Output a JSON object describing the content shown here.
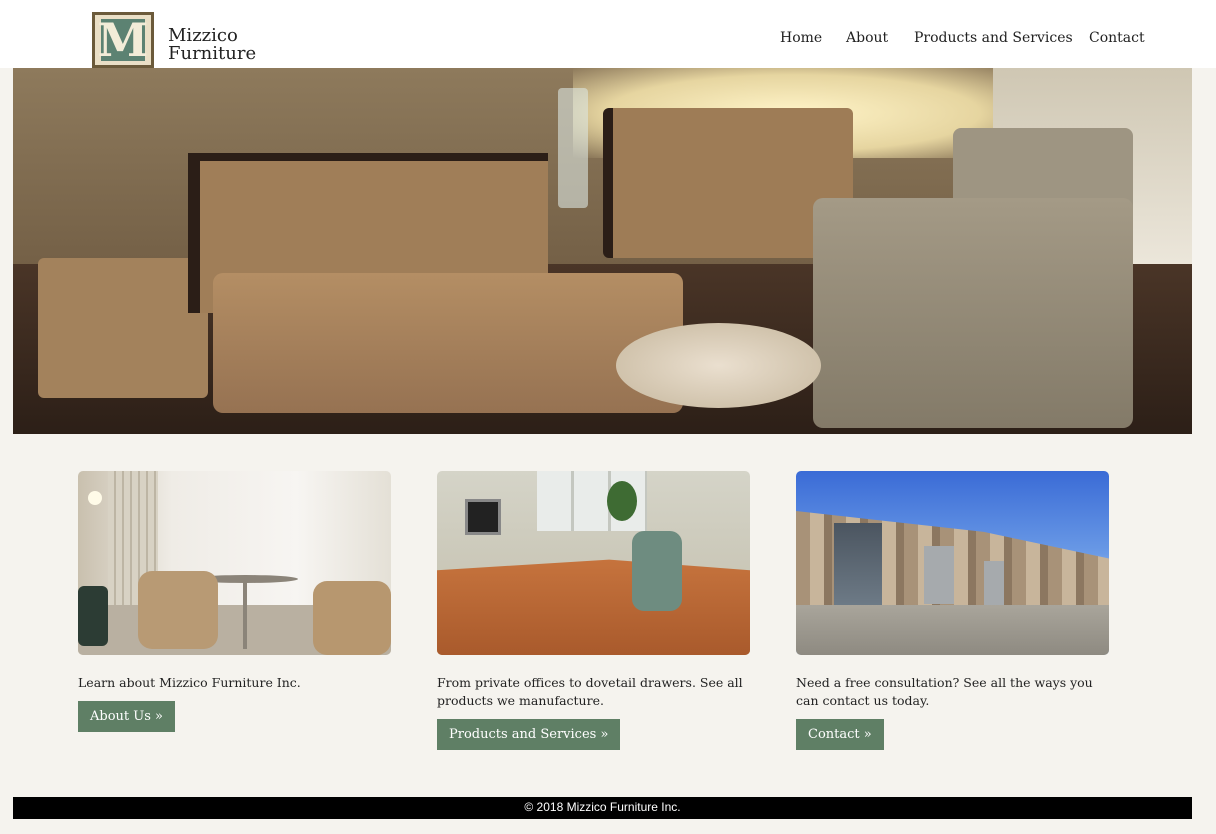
{
  "header": {
    "brand_line1": "Mizzico",
    "brand_line2": "Furniture",
    "logo_letter": "M",
    "nav": [
      {
        "label": "Home"
      },
      {
        "label": "About"
      },
      {
        "label": "Products and Services"
      },
      {
        "label": "Contact"
      }
    ]
  },
  "cards": [
    {
      "text": "Learn about Mizzico Furniture Inc.",
      "button": "About Us »",
      "image": "lounge-chairs-photo"
    },
    {
      "text": "From private offices to dovetail drawers. See all products we manufacture.",
      "button": "Products and Services »",
      "image": "office-desk-photo"
    },
    {
      "text": "Need a free consultation? See all the ways you can contact us today.",
      "button": "Contact »",
      "image": "building-exterior-photo"
    }
  ],
  "footer": {
    "copyright": "© 2018 Mizzico Furniture Inc."
  },
  "colors": {
    "button_bg": "#5f7f65",
    "page_bg": "#f5f3ee",
    "footer_bg": "#000000"
  }
}
